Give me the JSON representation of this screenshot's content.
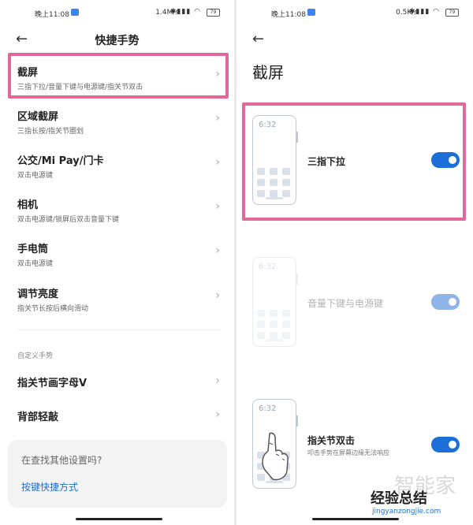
{
  "left": {
    "status": {
      "time": "晚上11:08",
      "net": "1.4M/s",
      "battery": "79"
    },
    "header": {
      "title": "快捷手势"
    },
    "items": [
      {
        "title": "截屏",
        "subtitle": "三指下拉/音量下键与电源键/指关节双击"
      },
      {
        "title": "区域截屏",
        "subtitle": "三指长按/指关节圈划"
      },
      {
        "title": "公交/Mi Pay/门卡",
        "subtitle": "双击电源键"
      },
      {
        "title": "相机",
        "subtitle": "双击电源键/锁屏后双击音量下键"
      },
      {
        "title": "手电筒",
        "subtitle": "双击电源键"
      },
      {
        "title": "调节亮度",
        "subtitle": "指关节长按后横向滑动"
      }
    ],
    "section": "自定义手势",
    "custom": [
      {
        "title": "指关节画字母V"
      },
      {
        "title": "背部轻敲"
      }
    ],
    "help": {
      "question": "在查找其他设置吗?",
      "link": "按键快捷方式"
    }
  },
  "right": {
    "status": {
      "time": "晚上11:08",
      "net": "0.5K/s",
      "battery": "79"
    },
    "title": "截屏",
    "options": [
      {
        "clock": "6:32",
        "label": "三指下拉",
        "sub": "",
        "enabled": true
      },
      {
        "clock": "6:32",
        "label": "音量下键与电源键",
        "sub": "",
        "enabled": true
      },
      {
        "clock": "6:32",
        "label": "指关节双击",
        "sub": "叩击手势在屏幕边缘无法响应",
        "enabled": true
      }
    ]
  },
  "watermark": {
    "text": "经验总结",
    "url": "jingyanzongjie.com",
    "bg": "智能家"
  },
  "colors": {
    "accent": "#1b6fd6",
    "highlight": "#e2679a"
  },
  "icons": {
    "back": "arrow-left-icon",
    "chevron": "chevron-right-icon"
  }
}
